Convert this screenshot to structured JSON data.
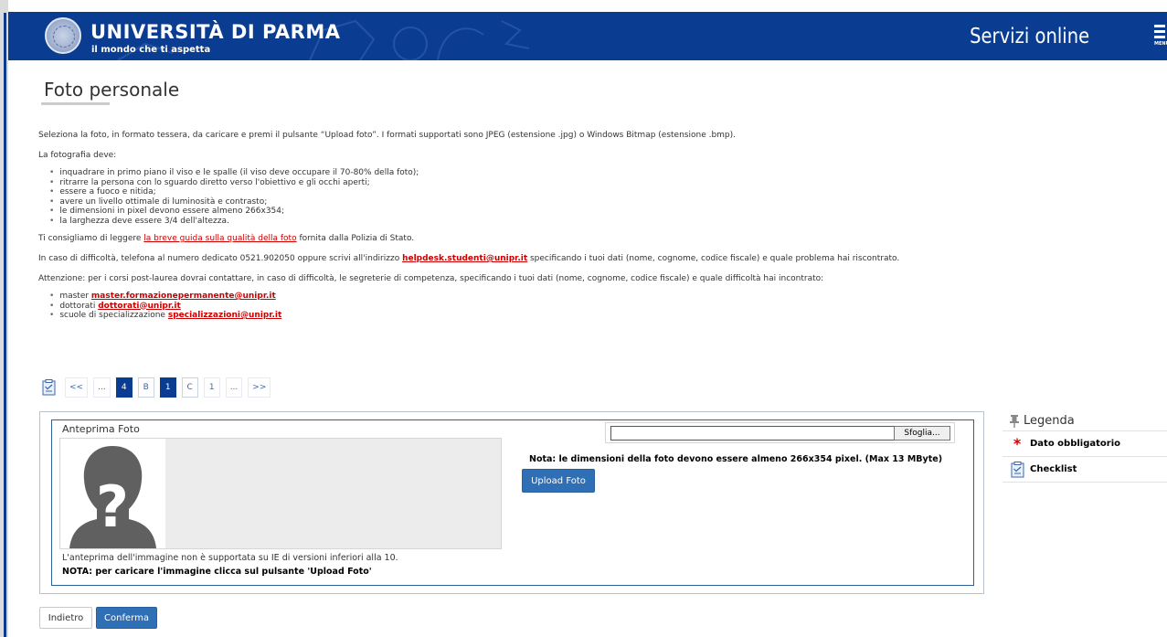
{
  "header": {
    "brand_title": "UNIVERSITÀ DI PARMA",
    "brand_tagline": "il mondo che ti aspetta",
    "service_title": "Servizi online",
    "menu_label": "MENU"
  },
  "page": {
    "title": "Foto personale"
  },
  "intro": {
    "p1": "Seleziona la foto, in formato tessera, da caricare e premi il pulsante “Upload foto”. I formati supportati sono JPEG (estensione .jpg) o Windows Bitmap (estensione .bmp).",
    "p2": "La fotografia deve:",
    "requirements": [
      "inquadrare in primo piano il viso e le spalle (il viso deve occupare il 70-80% della foto);",
      "ritrarre la persona con lo sguardo diretto verso l'obiettivo e gli occhi aperti;",
      "essere a fuoco e nitida;",
      "avere un livello ottimale di luminosità e contrasto;",
      "le dimensioni in pixel devono essere almeno 266x354;",
      "la larghezza deve essere 3/4 dell'altezza."
    ],
    "guide_before": "Ti consigliamo di leggere ",
    "guide_link": "la breve guida sulla qualità della foto",
    "guide_after": " fornita dalla Polizia di Stato.",
    "help_before": "In caso di difficoltà, telefona al numero dedicato 0521.902050 oppure scrivi all'indirizzo ",
    "help_email": "helpdesk.studenti@unipr.it",
    "help_after": " specificando i tuoi dati (nome, cognome, codice fiscale) e quale problema hai riscontrato.",
    "attention": "Attenzione: per i corsi post-laurea dovrai contattare, in caso di difficoltà, le segreterie di competenza, specificando i tuoi dati (nome, cognome, codice fiscale) e quale difficoltà hai incontrato:",
    "contacts": [
      {
        "label": "master ",
        "email": "master.formazionepermanente@unipr.it"
      },
      {
        "label": "dottorati ",
        "email": "dottorati@unipr.it"
      },
      {
        "label": "scuole di specializzazione ",
        "email": "specializzazioni@unipr.it"
      }
    ]
  },
  "pager": {
    "items": [
      "<<",
      "...",
      "4",
      "B",
      "1",
      "C",
      "1",
      "...",
      ">>"
    ]
  },
  "upload": {
    "preview_label": "Anteprima Foto",
    "browse_label": "Sfoglia...",
    "size_note": "Nota: le dimensioni della foto devono essere almeno 266x354 pixel. (Max 13 MByte)",
    "upload_button": "Upload Foto",
    "ie_note": "L'anteprima dell'immagine non è supportata su IE di versioni inferiori alla 10.",
    "upload_hint": "NOTA: per caricare l'immagine clicca sul pulsante 'Upload Foto'"
  },
  "legend": {
    "title": "Legenda",
    "required_label": "Dato obbligatorio",
    "checklist_label": "Checklist"
  },
  "actions": {
    "back": "Indietro",
    "confirm": "Conferma"
  },
  "colors": {
    "header_blue": "#0a3d91",
    "button_blue": "#2f6fb6",
    "link_red": "#cc0000"
  }
}
